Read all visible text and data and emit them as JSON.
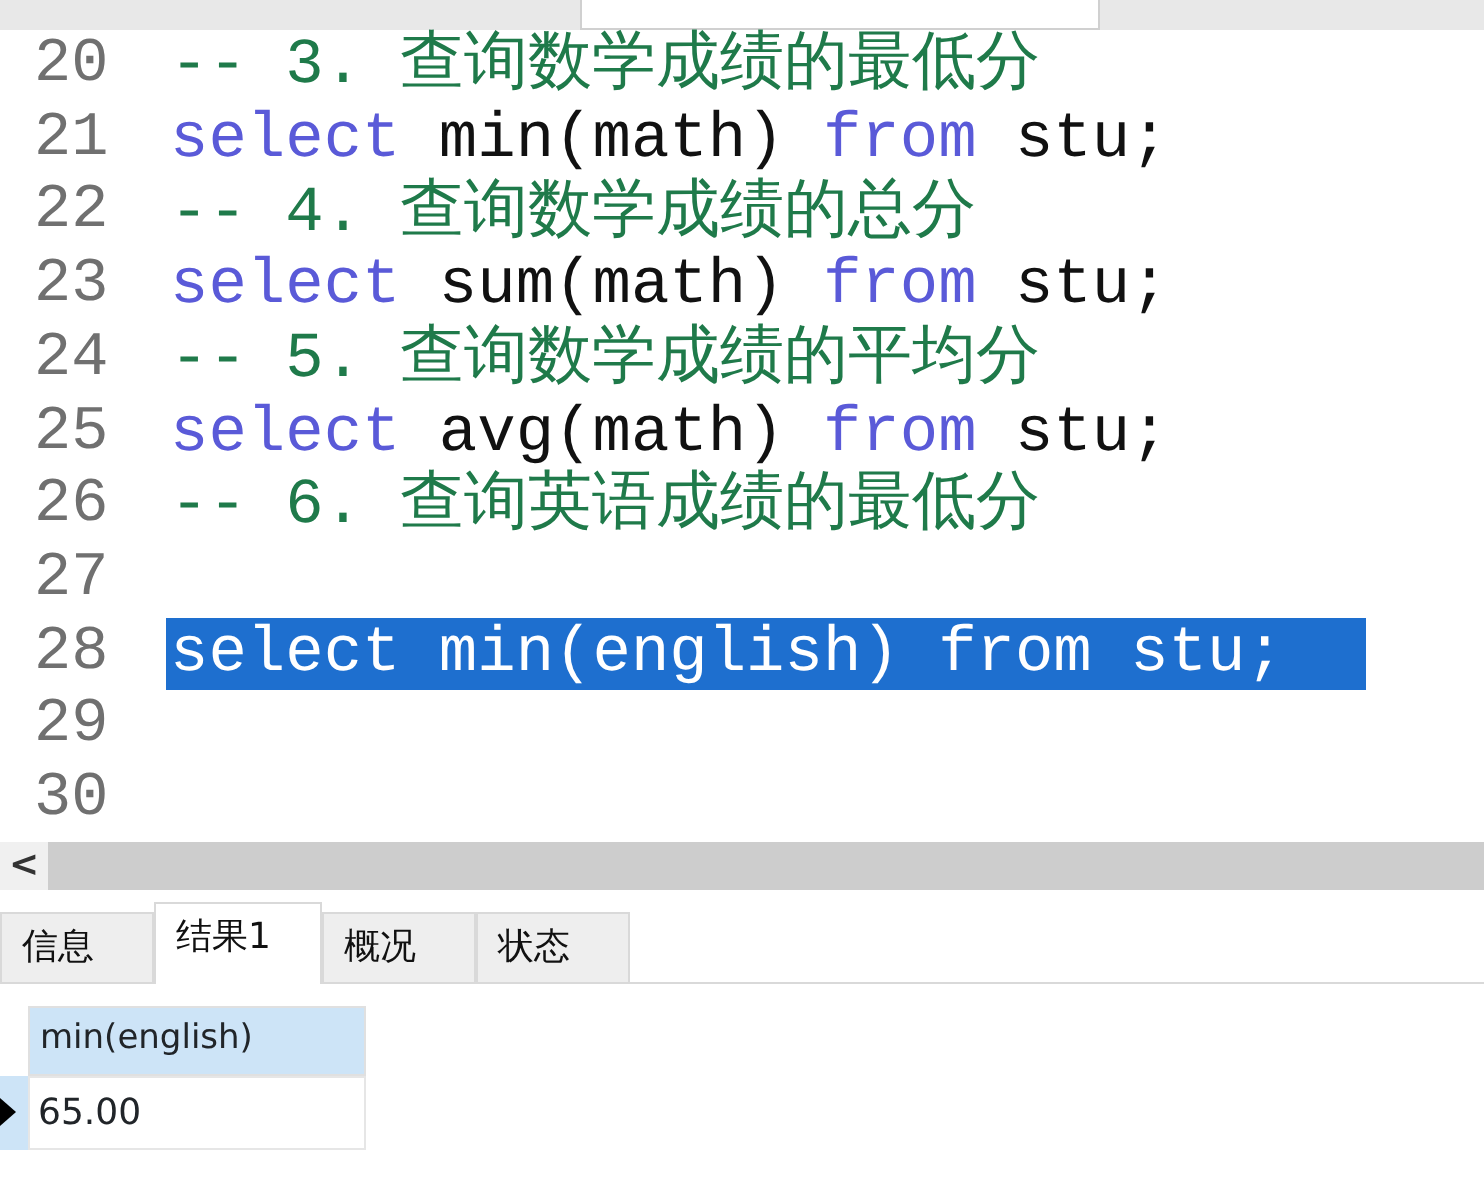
{
  "editor": {
    "lines": [
      {
        "number": "20",
        "selected": false,
        "tokens": [
          {
            "kind": "comment",
            "text": "-- 3. 查询数学成绩的最低分"
          }
        ]
      },
      {
        "number": "21",
        "selected": false,
        "tokens": [
          {
            "kind": "keyword",
            "text": "select"
          },
          {
            "kind": "plain",
            "text": " min(math) "
          },
          {
            "kind": "keyword",
            "text": "from"
          },
          {
            "kind": "plain",
            "text": " stu;"
          }
        ]
      },
      {
        "number": "22",
        "selected": false,
        "tokens": [
          {
            "kind": "comment",
            "text": "-- 4. 查询数学成绩的总分"
          }
        ]
      },
      {
        "number": "23",
        "selected": false,
        "tokens": [
          {
            "kind": "keyword",
            "text": "select"
          },
          {
            "kind": "plain",
            "text": " sum(math) "
          },
          {
            "kind": "keyword",
            "text": "from"
          },
          {
            "kind": "plain",
            "text": " stu;"
          }
        ]
      },
      {
        "number": "24",
        "selected": false,
        "tokens": [
          {
            "kind": "comment",
            "text": "-- 5. 查询数学成绩的平均分"
          }
        ]
      },
      {
        "number": "25",
        "selected": false,
        "tokens": [
          {
            "kind": "keyword",
            "text": "select"
          },
          {
            "kind": "plain",
            "text": " avg(math) "
          },
          {
            "kind": "keyword",
            "text": "from"
          },
          {
            "kind": "plain",
            "text": " stu;"
          }
        ]
      },
      {
        "number": "26",
        "selected": false,
        "tokens": [
          {
            "kind": "comment",
            "text": "-- 6. 查询英语成绩的最低分"
          }
        ]
      },
      {
        "number": "27",
        "selected": false
      },
      {
        "number": "28",
        "selected": true,
        "tokens": [
          {
            "kind": "keyword",
            "text": "select"
          },
          {
            "kind": "plain",
            "text": " min(english) "
          },
          {
            "kind": "keyword",
            "text": "from"
          },
          {
            "kind": "plain",
            "text": " stu;"
          }
        ]
      },
      {
        "number": "29",
        "selected": false
      },
      {
        "number": "30",
        "selected": false
      }
    ]
  },
  "scrollbar": {
    "arrow": "<"
  },
  "result_tabs": [
    {
      "label": "信息",
      "selected": false
    },
    {
      "label": "结果1",
      "selected": true
    },
    {
      "label": "概况",
      "selected": false
    },
    {
      "label": "状态",
      "selected": false
    }
  ],
  "grid": {
    "columns": [
      "min(english)"
    ],
    "rows": [
      {
        "current": true,
        "cells": [
          "65.00"
        ]
      }
    ]
  }
}
